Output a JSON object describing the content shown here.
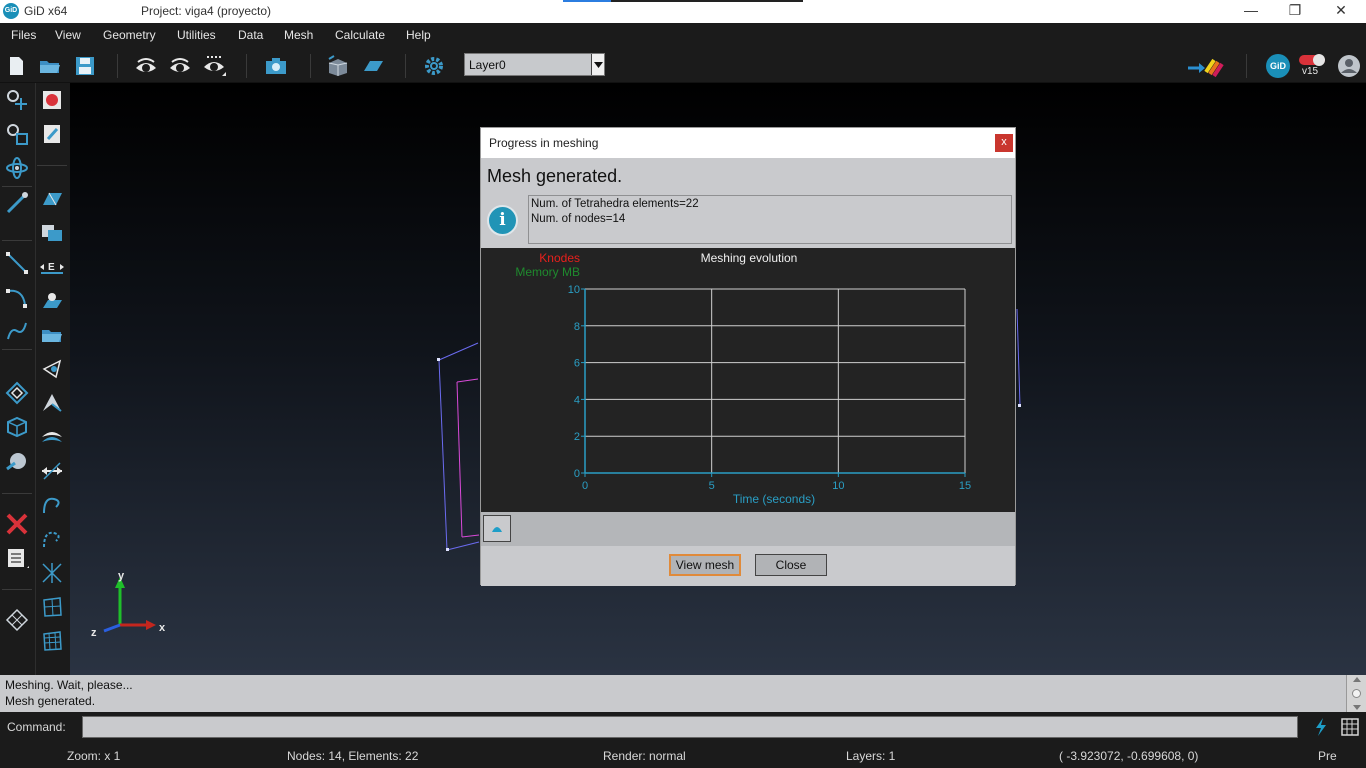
{
  "window": {
    "app_name": "GiD x64",
    "logo_text": "GiD",
    "project_title": "Project: viga4 (proyecto)",
    "minimize": "—",
    "restore": "❐",
    "close": "✕"
  },
  "menu": [
    "Files",
    "View",
    "Geometry",
    "Utilities",
    "Data",
    "Mesh",
    "Calculate",
    "Help"
  ],
  "toolbar": {
    "layer_value": "Layer0",
    "version_label": "v15",
    "badge_text": "GiD",
    "icons": [
      "new-file-icon",
      "open-folder-icon",
      "save-icon",
      "eye-icon",
      "eye-rotate-icon",
      "eye-options-icon",
      "camera-icon",
      "mesh-boxes-icon",
      "surface-icon",
      "settings-gear-icon",
      "arrow-rainbow-icon",
      "gid-logo-icon",
      "toggle-icon",
      "user-icon"
    ]
  },
  "dialog": {
    "title": "Progress in meshing",
    "close_label": "x",
    "heading": "Mesh generated.",
    "info_lines": [
      "Num. of Tetrahedra elements=22",
      "Num. of nodes=14"
    ],
    "view_mesh_label": "View mesh",
    "close_button_label": "Close"
  },
  "chart_data": {
    "type": "line",
    "title": "Meshing evolution",
    "xlabel": "Time (seconds)",
    "ylabel": "",
    "xlim": [
      0,
      15
    ],
    "ylim": [
      0,
      10
    ],
    "x_ticks": [
      0,
      5,
      10,
      15
    ],
    "y_ticks": [
      0,
      2,
      4,
      6,
      8,
      10
    ],
    "grid": true,
    "series": [
      {
        "name": "Knodes",
        "color": "#e8201c",
        "values": []
      },
      {
        "name": "Memory MB",
        "color": "#1f8a2e",
        "values": []
      }
    ],
    "legend_placement": "top-left",
    "axis_color": "#2a9ec4"
  },
  "axes_labels": {
    "x": "x",
    "y": "y",
    "z": "z"
  },
  "output": [
    "Meshing. Wait, please...",
    "Mesh generated."
  ],
  "command": {
    "label": "Command:",
    "value": ""
  },
  "status": {
    "zoom": "Zoom: x 1",
    "counts": "Nodes: 14, Elements: 22",
    "render": "Render: normal",
    "layers": "Layers: 1",
    "coords": "( -3.923072, -0.699608,  0)",
    "mode": "Pre"
  }
}
